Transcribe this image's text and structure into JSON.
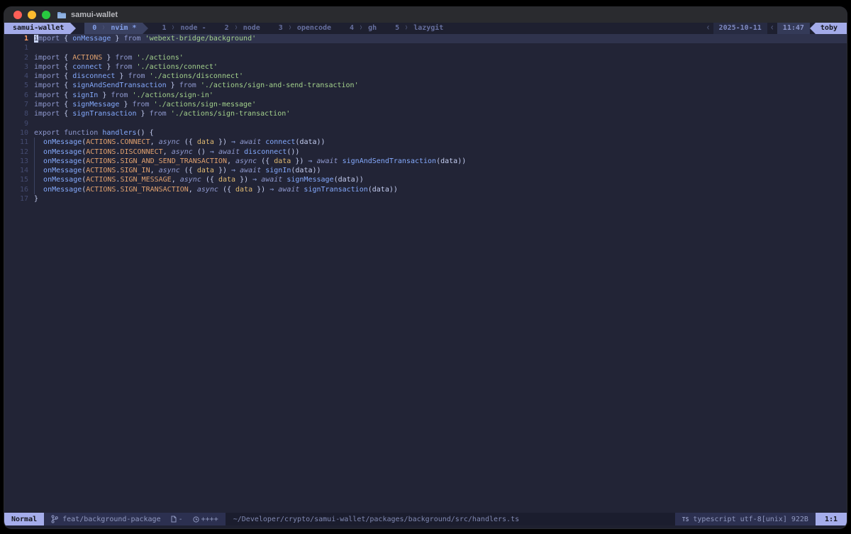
{
  "titlebar": {
    "title": "samui-wallet"
  },
  "tmux": {
    "session": "samui-wallet",
    "windows": [
      {
        "index": "0",
        "name": "nvim",
        "flag": "*",
        "active": true
      },
      {
        "index": "1",
        "name": "node",
        "flag": "-",
        "active": false
      },
      {
        "index": "2",
        "name": "node",
        "flag": "",
        "active": false
      },
      {
        "index": "3",
        "name": "opencode",
        "flag": "",
        "active": false
      },
      {
        "index": "4",
        "name": "gh",
        "flag": "",
        "active": false
      },
      {
        "index": "5",
        "name": "lazygit",
        "flag": "",
        "active": false
      }
    ],
    "date": "2025-10-11",
    "time": "11:47",
    "user": "toby"
  },
  "editor": {
    "lines": [
      {
        "num": "1",
        "current": true,
        "tokens": [
          [
            "cur",
            "i"
          ],
          [
            "k",
            "mport"
          ],
          [
            "p",
            " { "
          ],
          [
            "v",
            "onMessage"
          ],
          [
            "p",
            " } "
          ],
          [
            "k",
            "from"
          ],
          [
            "p",
            " "
          ],
          [
            "s",
            "'webext-bridge/background'"
          ]
        ]
      },
      {
        "num": "1",
        "tokens": []
      },
      {
        "num": "2",
        "tokens": [
          [
            "k",
            "import"
          ],
          [
            "p",
            " { "
          ],
          [
            "c",
            "ACTIONS"
          ],
          [
            "p",
            " } "
          ],
          [
            "k",
            "from"
          ],
          [
            "p",
            " "
          ],
          [
            "s",
            "'./actions'"
          ]
        ]
      },
      {
        "num": "3",
        "tokens": [
          [
            "k",
            "import"
          ],
          [
            "p",
            " { "
          ],
          [
            "v",
            "connect"
          ],
          [
            "p",
            " } "
          ],
          [
            "k",
            "from"
          ],
          [
            "p",
            " "
          ],
          [
            "s",
            "'./actions/connect'"
          ]
        ]
      },
      {
        "num": "4",
        "tokens": [
          [
            "k",
            "import"
          ],
          [
            "p",
            " { "
          ],
          [
            "v",
            "disconnect"
          ],
          [
            "p",
            " } "
          ],
          [
            "k",
            "from"
          ],
          [
            "p",
            " "
          ],
          [
            "s",
            "'./actions/disconnect'"
          ]
        ]
      },
      {
        "num": "5",
        "tokens": [
          [
            "k",
            "import"
          ],
          [
            "p",
            " { "
          ],
          [
            "v",
            "signAndSendTransaction"
          ],
          [
            "p",
            " } "
          ],
          [
            "k",
            "from"
          ],
          [
            "p",
            " "
          ],
          [
            "s",
            "'./actions/sign-and-send-transaction'"
          ]
        ]
      },
      {
        "num": "6",
        "tokens": [
          [
            "k",
            "import"
          ],
          [
            "p",
            " { "
          ],
          [
            "v",
            "signIn"
          ],
          [
            "p",
            " } "
          ],
          [
            "k",
            "from"
          ],
          [
            "p",
            " "
          ],
          [
            "s",
            "'./actions/sign-in'"
          ]
        ]
      },
      {
        "num": "7",
        "tokens": [
          [
            "k",
            "import"
          ],
          [
            "p",
            " { "
          ],
          [
            "v",
            "signMessage"
          ],
          [
            "p",
            " } "
          ],
          [
            "k",
            "from"
          ],
          [
            "p",
            " "
          ],
          [
            "s",
            "'./actions/sign-message'"
          ]
        ]
      },
      {
        "num": "8",
        "tokens": [
          [
            "k",
            "import"
          ],
          [
            "p",
            " { "
          ],
          [
            "v",
            "signTransaction"
          ],
          [
            "p",
            " } "
          ],
          [
            "k",
            "from"
          ],
          [
            "p",
            " "
          ],
          [
            "s",
            "'./actions/sign-transaction'"
          ]
        ]
      },
      {
        "num": "9",
        "tokens": []
      },
      {
        "num": "10",
        "tokens": [
          [
            "k",
            "export"
          ],
          [
            "p",
            " "
          ],
          [
            "k",
            "function"
          ],
          [
            "p",
            " "
          ],
          [
            "v",
            "handlers"
          ],
          [
            "p",
            "() {"
          ]
        ]
      },
      {
        "num": "11",
        "tokens": [
          [
            "ind",
            "  "
          ],
          [
            "v",
            "onMessage"
          ],
          [
            "p",
            "("
          ],
          [
            "c",
            "ACTIONS"
          ],
          [
            "p",
            "."
          ],
          [
            "c",
            "CONNECT"
          ],
          [
            "p",
            ", "
          ],
          [
            "i",
            "async"
          ],
          [
            "p",
            " ({ "
          ],
          [
            "y",
            "data"
          ],
          [
            "p",
            " }) "
          ],
          [
            "a",
            "⇒"
          ],
          [
            "p",
            " "
          ],
          [
            "i",
            "await"
          ],
          [
            "p",
            " "
          ],
          [
            "v",
            "connect"
          ],
          [
            "p",
            "("
          ],
          [
            "w",
            "data"
          ],
          [
            "p",
            "))"
          ]
        ]
      },
      {
        "num": "12",
        "tokens": [
          [
            "ind",
            "  "
          ],
          [
            "v",
            "onMessage"
          ],
          [
            "p",
            "("
          ],
          [
            "c",
            "ACTIONS"
          ],
          [
            "p",
            "."
          ],
          [
            "c",
            "DISCONNECT"
          ],
          [
            "p",
            ", "
          ],
          [
            "i",
            "async"
          ],
          [
            "p",
            " () "
          ],
          [
            "a",
            "⇒"
          ],
          [
            "p",
            " "
          ],
          [
            "i",
            "await"
          ],
          [
            "p",
            " "
          ],
          [
            "v",
            "disconnect"
          ],
          [
            "p",
            "())"
          ]
        ]
      },
      {
        "num": "13",
        "tokens": [
          [
            "ind",
            "  "
          ],
          [
            "v",
            "onMessage"
          ],
          [
            "p",
            "("
          ],
          [
            "c",
            "ACTIONS"
          ],
          [
            "p",
            "."
          ],
          [
            "c",
            "SIGN_AND_SEND_TRANSACTION"
          ],
          [
            "p",
            ", "
          ],
          [
            "i",
            "async"
          ],
          [
            "p",
            " ({ "
          ],
          [
            "y",
            "data"
          ],
          [
            "p",
            " }) "
          ],
          [
            "a",
            "⇒"
          ],
          [
            "p",
            " "
          ],
          [
            "i",
            "await"
          ],
          [
            "p",
            " "
          ],
          [
            "v",
            "signAndSendTransaction"
          ],
          [
            "p",
            "("
          ],
          [
            "w",
            "data"
          ],
          [
            "p",
            "))"
          ]
        ]
      },
      {
        "num": "14",
        "tokens": [
          [
            "ind",
            "  "
          ],
          [
            "v",
            "onMessage"
          ],
          [
            "p",
            "("
          ],
          [
            "c",
            "ACTIONS"
          ],
          [
            "p",
            "."
          ],
          [
            "c",
            "SIGN_IN"
          ],
          [
            "p",
            ", "
          ],
          [
            "i",
            "async"
          ],
          [
            "p",
            " ({ "
          ],
          [
            "y",
            "data"
          ],
          [
            "p",
            " }) "
          ],
          [
            "a",
            "⇒"
          ],
          [
            "p",
            " "
          ],
          [
            "i",
            "await"
          ],
          [
            "p",
            " "
          ],
          [
            "v",
            "signIn"
          ],
          [
            "p",
            "("
          ],
          [
            "w",
            "data"
          ],
          [
            "p",
            "))"
          ]
        ]
      },
      {
        "num": "15",
        "tokens": [
          [
            "ind",
            "  "
          ],
          [
            "v",
            "onMessage"
          ],
          [
            "p",
            "("
          ],
          [
            "c",
            "ACTIONS"
          ],
          [
            "p",
            "."
          ],
          [
            "c",
            "SIGN_MESSAGE"
          ],
          [
            "p",
            ", "
          ],
          [
            "i",
            "async"
          ],
          [
            "p",
            " ({ "
          ],
          [
            "y",
            "data"
          ],
          [
            "p",
            " }) "
          ],
          [
            "a",
            "⇒"
          ],
          [
            "p",
            " "
          ],
          [
            "i",
            "await"
          ],
          [
            "p",
            " "
          ],
          [
            "v",
            "signMessage"
          ],
          [
            "p",
            "("
          ],
          [
            "w",
            "data"
          ],
          [
            "p",
            "))"
          ]
        ]
      },
      {
        "num": "16",
        "tokens": [
          [
            "ind",
            "  "
          ],
          [
            "v",
            "onMessage"
          ],
          [
            "p",
            "("
          ],
          [
            "c",
            "ACTIONS"
          ],
          [
            "p",
            "."
          ],
          [
            "c",
            "SIGN_TRANSACTION"
          ],
          [
            "p",
            ", "
          ],
          [
            "i",
            "async"
          ],
          [
            "p",
            " ({ "
          ],
          [
            "y",
            "data"
          ],
          [
            "p",
            " }) "
          ],
          [
            "a",
            "⇒"
          ],
          [
            "p",
            " "
          ],
          [
            "i",
            "await"
          ],
          [
            "p",
            " "
          ],
          [
            "v",
            "signTransaction"
          ],
          [
            "p",
            "("
          ],
          [
            "w",
            "data"
          ],
          [
            "p",
            "))"
          ]
        ]
      },
      {
        "num": "17",
        "tokens": [
          [
            "p",
            "}"
          ]
        ]
      }
    ]
  },
  "statusline": {
    "mode": "Normal",
    "git_branch": "feat/background-package",
    "doc_badge": "-",
    "clock_badge": "++++",
    "file_path": "~/Developer/crypto/samui-wallet/packages/background/src/handlers.ts",
    "lsp_icon": "TS",
    "filetype": "typescript",
    "encoding": "utf-8[unix]",
    "size": "922B",
    "position": "1:1"
  },
  "colors": {
    "screen_bg": "#000000",
    "editor_bg": "#222436",
    "bar_bg": "#1e2030",
    "accent": "#a3abe9",
    "cursorline": "#2f334d",
    "active_window_bg": "#3a4161",
    "keyword": "#8f99cf",
    "function_blue": "#84a9fc",
    "string_green": "#a3d18c",
    "constant_orange": "#dfa06e",
    "param_yellow": "#e0ba72",
    "current_linenr": "#ff9e64",
    "traffic_red": "#ff5f57",
    "traffic_yellow": "#febc2e",
    "traffic_green": "#28c840"
  }
}
